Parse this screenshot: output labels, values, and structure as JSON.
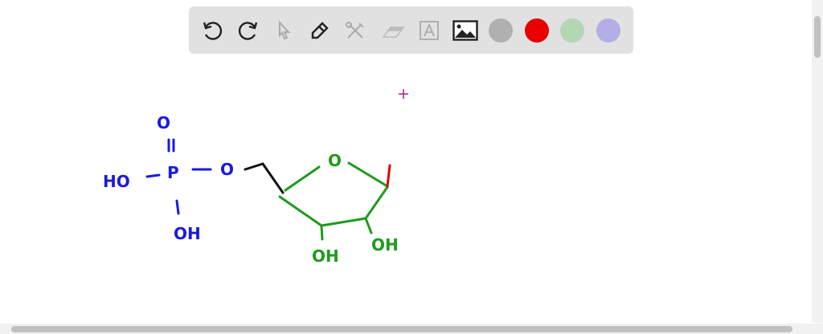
{
  "toolbar": {
    "tools": [
      "undo-icon",
      "redo-icon",
      "select-icon",
      "pen-icon",
      "tools-icon",
      "eraser-icon",
      "text-icon",
      "image-icon"
    ],
    "colors": [
      "#b0b0b0",
      "#e60000",
      "#b3d6b3",
      "#b3aee6"
    ]
  },
  "drawing": {
    "phosphate_o_top": "O",
    "ho_left": "HO",
    "p": "P",
    "o_link": "O",
    "oh_bottom": "OH",
    "ring_o": "O",
    "oh_ring_left": "OH",
    "oh_ring_right": "OH",
    "colors": {
      "blue": "#1a1adb",
      "green": "#1e9a1e",
      "black": "#111111",
      "red": "#e00000",
      "cursor": "#a0208f"
    }
  }
}
